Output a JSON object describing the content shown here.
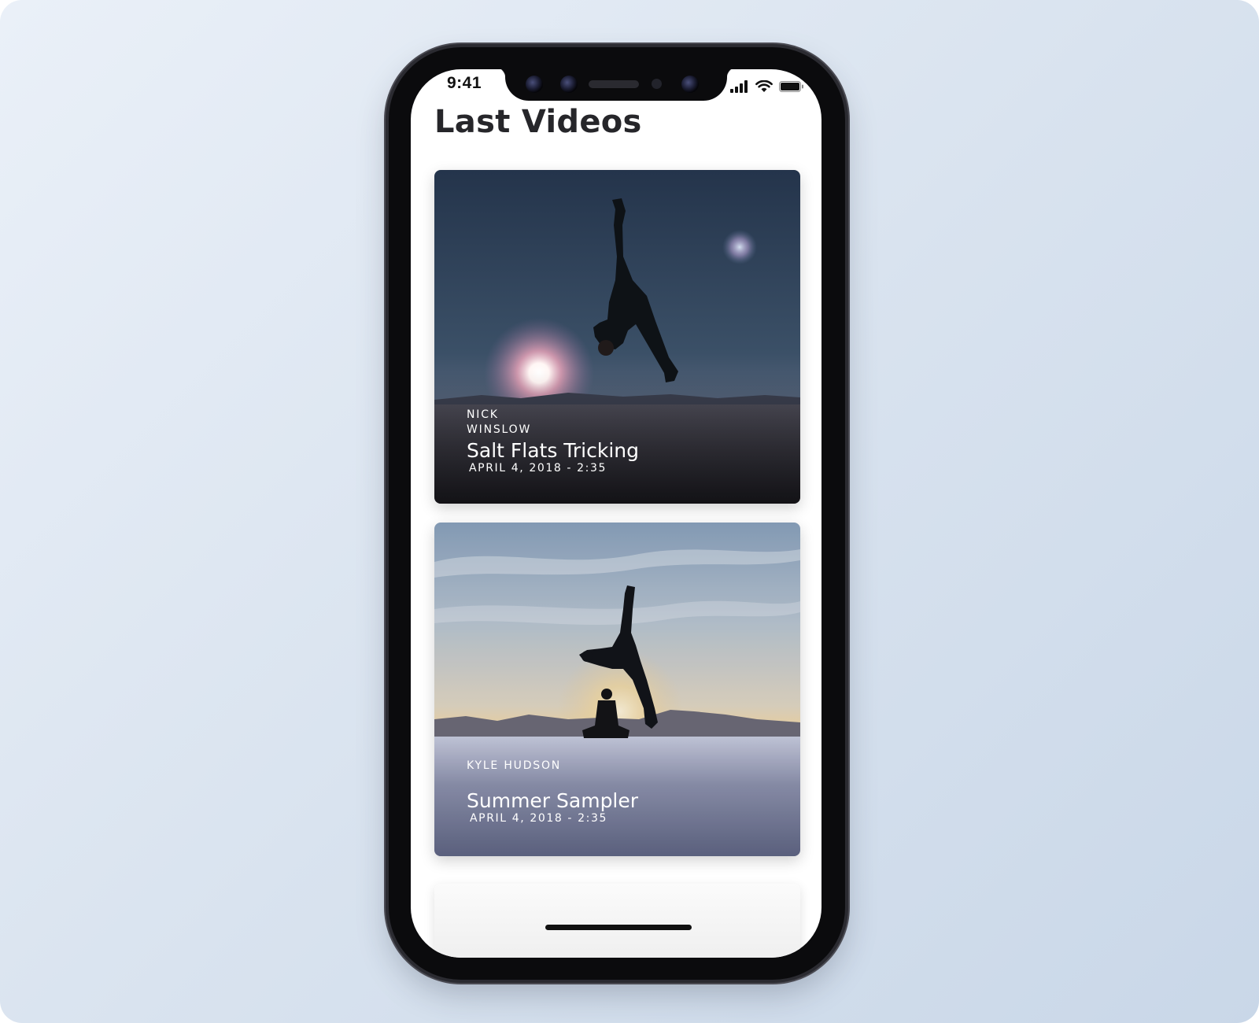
{
  "status_bar": {
    "time": "9:41"
  },
  "page": {
    "title": "Last Videos"
  },
  "videos": [
    {
      "author_first": "NICK",
      "author_last": "WINSLOW",
      "title": "Salt Flats Tricking",
      "date": "APRIL 4, 2018 - 2:35"
    },
    {
      "author": "KYLE HUDSON",
      "title": "Summer Sampler",
      "date": "APRIL 4, 2018 - 2:35"
    }
  ],
  "icons": {
    "signal": "signal-bars-icon",
    "wifi": "wifi-icon",
    "battery": "battery-icon"
  },
  "colors": {
    "title": "#26262a",
    "background_start": "#eaf0f8",
    "background_end": "#c9d7e8",
    "phone_frame": "#0b0b0d"
  }
}
